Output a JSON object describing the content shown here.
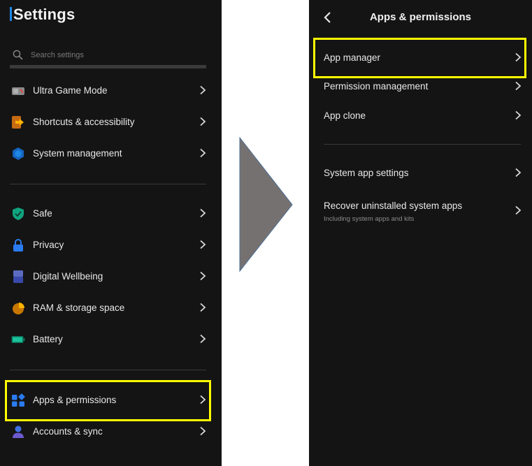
{
  "left": {
    "title": "Settings",
    "search": {
      "placeholder": "Search settings",
      "value": ""
    },
    "group1": [
      {
        "label": "Ultra Game Mode",
        "icon": "game-controller-icon"
      },
      {
        "label": "Shortcuts & accessibility",
        "icon": "shortcut-arrow-icon"
      },
      {
        "label": "System management",
        "icon": "hexagon-system-icon"
      }
    ],
    "group2": [
      {
        "label": "Safe",
        "icon": "shield-check-icon"
      },
      {
        "label": "Privacy",
        "icon": "lock-icon"
      },
      {
        "label": "Digital Wellbeing",
        "icon": "hourglass-icon"
      },
      {
        "label": "RAM & storage space",
        "icon": "pie-storage-icon"
      },
      {
        "label": "Battery",
        "icon": "battery-icon"
      }
    ],
    "group3": [
      {
        "label": "Apps & permissions",
        "icon": "apps-grid-icon"
      },
      {
        "label": "Accounts & sync",
        "icon": "person-icon"
      }
    ]
  },
  "right": {
    "title": "Apps & permissions",
    "group1": [
      {
        "label": "App manager"
      },
      {
        "label": "Permission management"
      },
      {
        "label": "App clone"
      }
    ],
    "group2": [
      {
        "label": "System app settings",
        "sublabel": ""
      },
      {
        "label": "Recover uninstalled system apps",
        "sublabel": "Including system apps and kits"
      }
    ]
  },
  "colors": {
    "background": "#141414",
    "highlight": "#ffff00",
    "arrow": "#767171",
    "accent": "#1e88e5"
  }
}
